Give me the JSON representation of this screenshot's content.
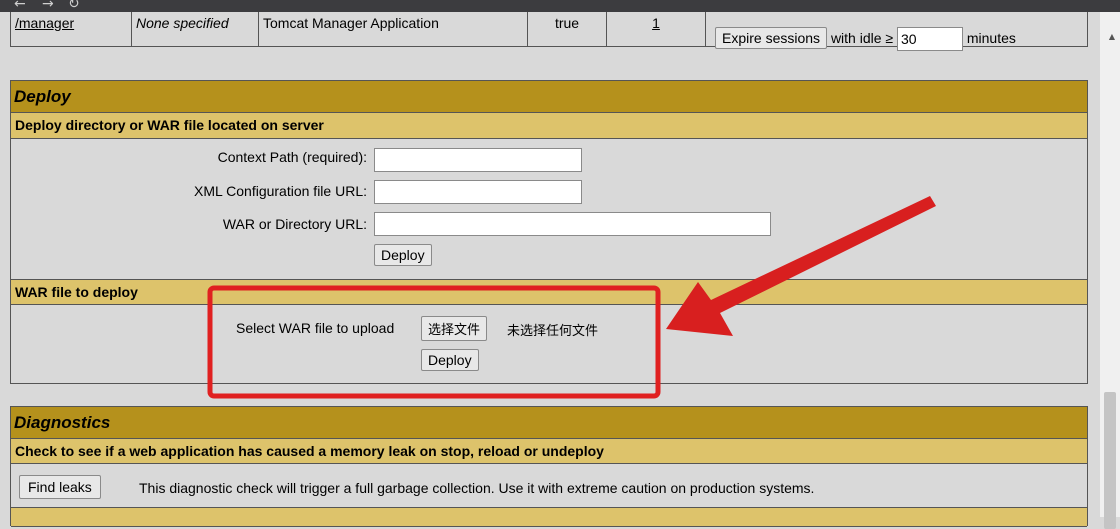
{
  "apps_row": {
    "path": "/manager",
    "version": "None specified",
    "display_name": "Tomcat Manager Application",
    "running": "true",
    "sessions": "1",
    "expire_button": "Expire sessions",
    "with_idle": "with idle ≥",
    "idle_value": "30",
    "minutes": "minutes"
  },
  "deploy": {
    "title": "Deploy",
    "server_subtitle": "Deploy directory or WAR file located on server",
    "context_path_label": "Context Path (required):",
    "xml_config_label": "XML Configuration file URL:",
    "war_dir_label": "WAR or Directory URL:",
    "deploy_button": "Deploy",
    "war_subtitle": "WAR file to deploy",
    "select_label": "Select WAR file to upload",
    "choose_file_button": "选择文件",
    "no_file_text": "未选择任何文件",
    "upload_deploy_button": "Deploy"
  },
  "diagnostics": {
    "title": "Diagnostics",
    "subtitle": "Check to see if a web application has caused a memory leak on stop, reload or undeploy",
    "find_leaks_button": "Find leaks",
    "description": "This diagnostic check will trigger a full garbage collection. Use it with extreme caution on production systems."
  },
  "annotation": {
    "highlight_color": "#e02020",
    "arrow_color": "#d81f1f"
  },
  "icons": [
    "back-arrow-icon",
    "forward-arrow-icon",
    "reload-icon",
    "scroll-up-icon"
  ]
}
